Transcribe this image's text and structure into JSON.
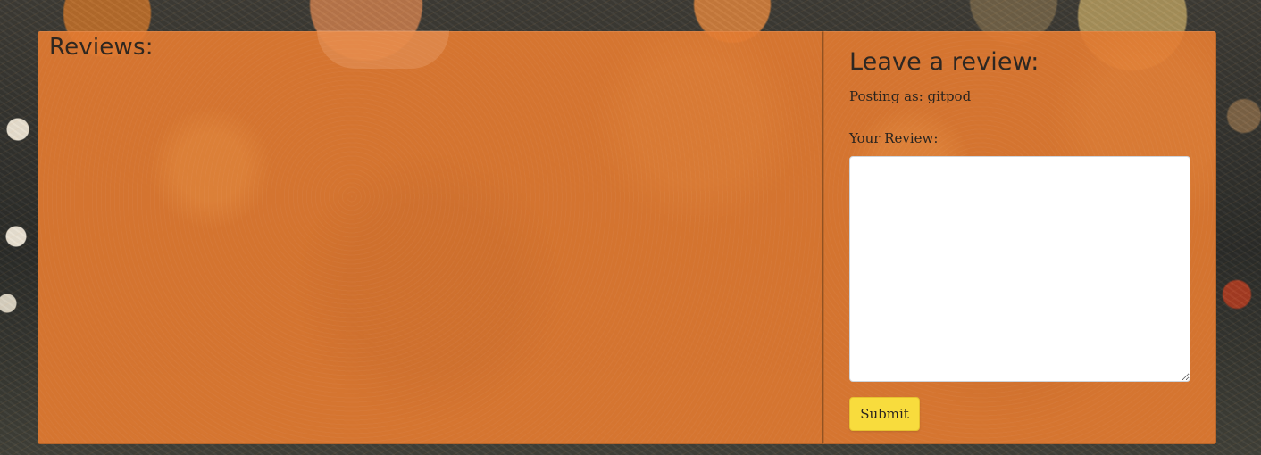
{
  "reviews_section": {
    "title": "Reviews:"
  },
  "review_form": {
    "title": "Leave a review:",
    "posting_as": "Posting as: gitpod",
    "review_label": "Your Review:",
    "review_textarea": {
      "value": "",
      "placeholder": ""
    },
    "submit_label": "Submit"
  },
  "colors": {
    "panel_background": "#e17a30",
    "submit_button": "#f8dc3d",
    "text": "#2a241f",
    "page_background": "#343330"
  },
  "icons": {
    "textarea_resize": "resize-handle-icon"
  }
}
